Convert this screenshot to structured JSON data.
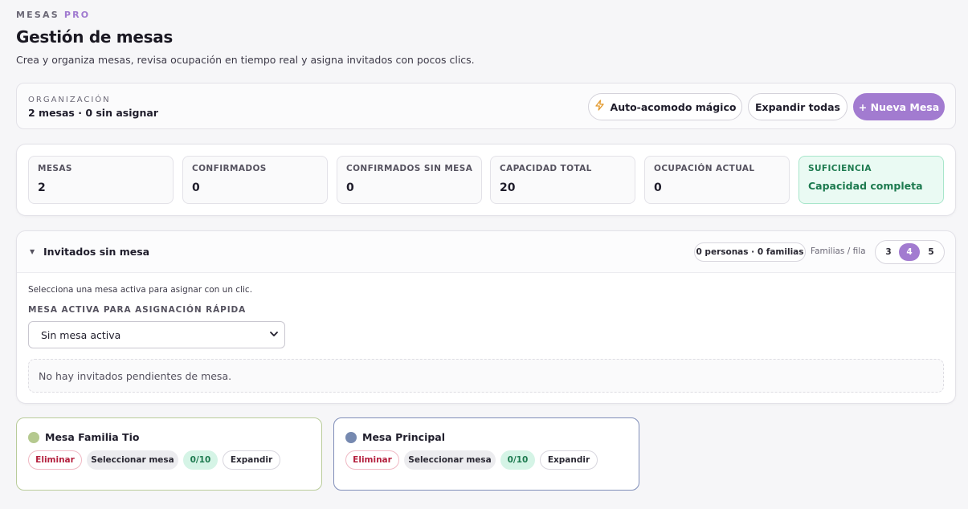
{
  "brand": {
    "name": "MESAS",
    "suffix": "PRO"
  },
  "header": {
    "title": "Gestión de mesas",
    "subtitle": "Crea y organiza mesas, revisa ocupación en tiempo real y asigna invitados con pocos clics."
  },
  "organization": {
    "label": "ORGANIZACIÓN",
    "summary": "2 mesas · 0 sin asignar",
    "actions": {
      "auto_label": "Auto-acomodo mágico",
      "expand_label": "Expandir todas",
      "new_label": "+ Nueva Mesa"
    }
  },
  "stats": [
    {
      "label": "MESAS",
      "value": "2"
    },
    {
      "label": "CONFIRMADOS",
      "value": "0"
    },
    {
      "label": "CONFIRMADOS SIN MESA",
      "value": "0"
    },
    {
      "label": "CAPACIDAD TOTAL",
      "value": "20"
    },
    {
      "label": "OCUPACIÓN ACTUAL",
      "value": "0"
    },
    {
      "label": "SUFICIENCIA",
      "value": "Capacidad completa"
    }
  ],
  "unassigned": {
    "title": "Invitados sin mesa",
    "count_pill": "0 personas · 0 familias",
    "per_row_label": "Familias / fila",
    "per_row_options": [
      "3",
      "4",
      "5"
    ],
    "per_row_selected": "4",
    "hint": "Selecciona una mesa activa para asignar con un clic.",
    "quick_assign_label": "MESA ACTIVA PARA ASIGNACIÓN RÁPIDA",
    "quick_assign_value": "Sin mesa activa",
    "empty_text": "No hay invitados pendientes de mesa."
  },
  "tables": [
    {
      "name": "Mesa Familia Tio",
      "color": "#b5c98f",
      "border": "#b9cc9a",
      "delete_label": "Eliminar",
      "select_label": "Seleccionar mesa",
      "occupancy": "0/10",
      "expand_label": "Expandir"
    },
    {
      "name": "Mesa Principal",
      "color": "#7689b0",
      "border": "#7f8db8",
      "delete_label": "Eliminar",
      "select_label": "Seleccionar mesa",
      "occupancy": "0/10",
      "expand_label": "Expandir"
    }
  ],
  "colors": {
    "accent": "#a27bd0",
    "success_bg": "#eafaf3",
    "success_text": "#1d7a4f",
    "danger": "#b4213e"
  }
}
